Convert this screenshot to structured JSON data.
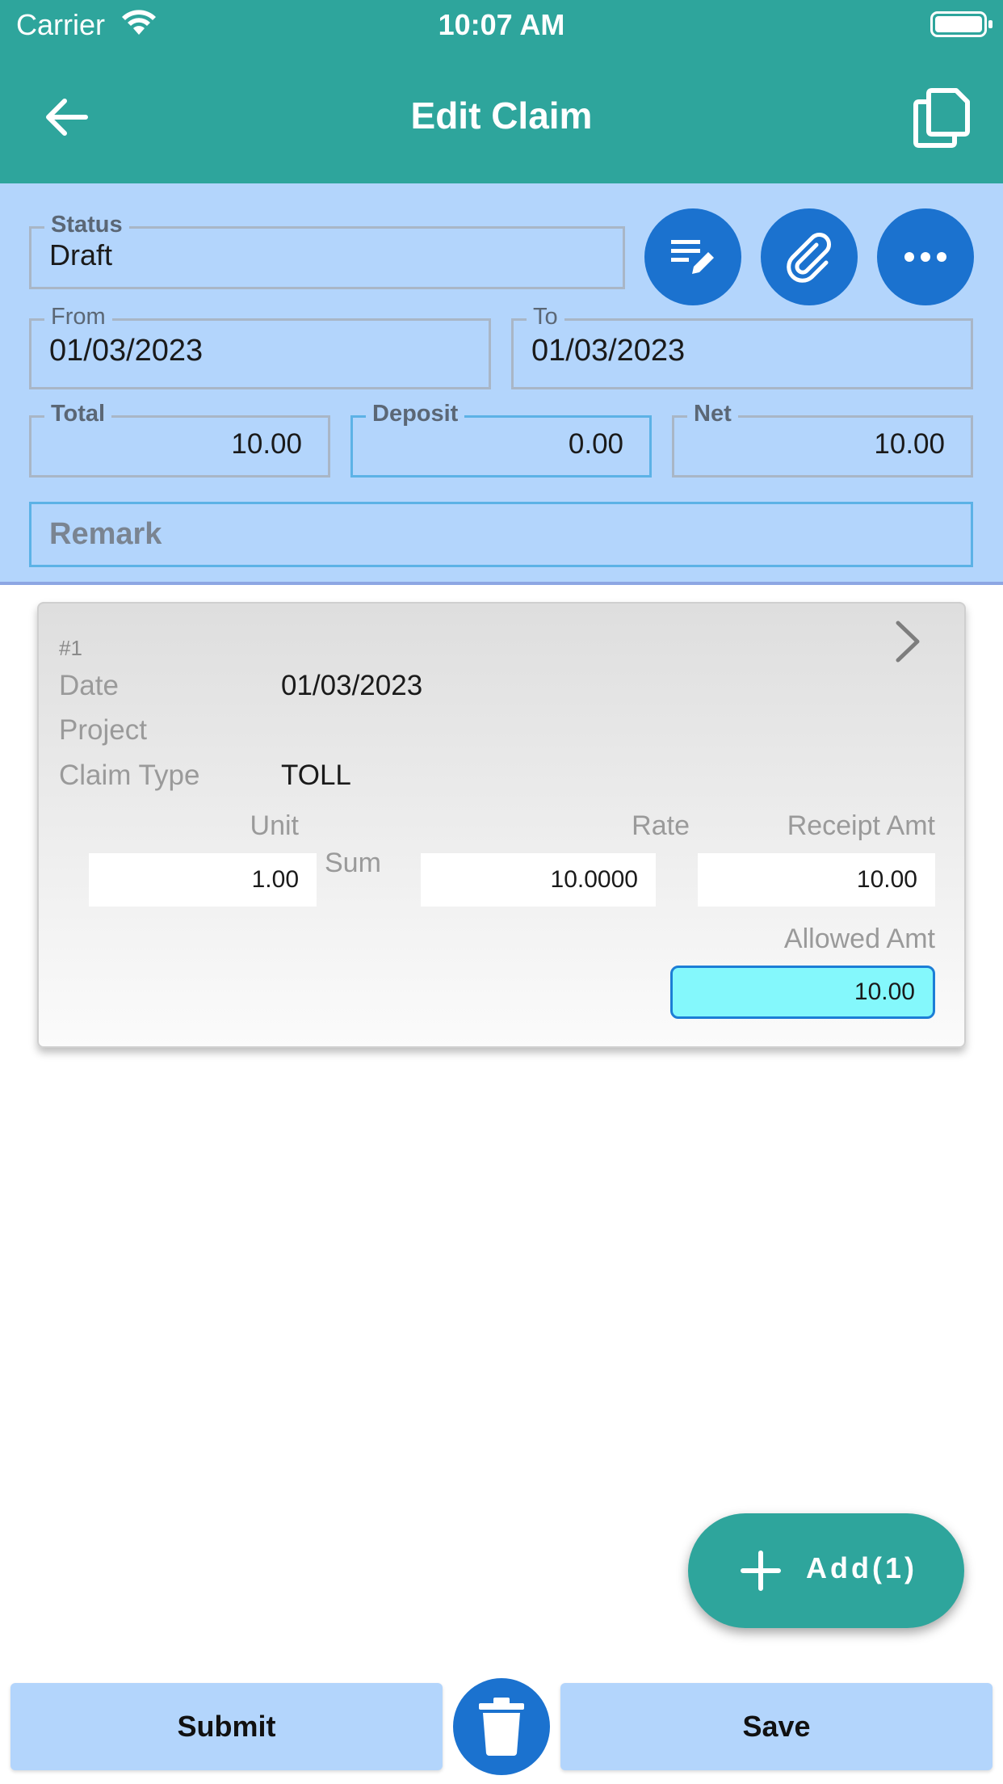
{
  "status_bar": {
    "carrier": "Carrier",
    "time": "10:07 AM"
  },
  "app_bar": {
    "title": "Edit Claim",
    "back_icon": "arrow-back-icon",
    "copy_icon": "copy-icon"
  },
  "header": {
    "status": {
      "label": "Status",
      "value": "Draft"
    },
    "actions": [
      {
        "icon": "edit-notes-icon"
      },
      {
        "icon": "paperclip-icon"
      },
      {
        "icon": "more-horizontal-icon"
      }
    ],
    "from": {
      "label": "From",
      "value": "01/03/2023"
    },
    "to": {
      "label": "To",
      "value": "01/03/2023"
    },
    "total": {
      "label": "Total",
      "value": "10.00"
    },
    "deposit": {
      "label": "Deposit",
      "value": "0.00"
    },
    "net": {
      "label": "Net",
      "value": "10.00"
    },
    "remark": {
      "placeholder": "Remark",
      "value": ""
    }
  },
  "claim_items": [
    {
      "index": "#1",
      "date_label": "Date",
      "date": "01/03/2023",
      "project_label": "Project",
      "project": "",
      "claim_type_label": "Claim Type",
      "claim_type": "TOLL",
      "unit_label": "Unit",
      "unit": "1.00",
      "sum_label": "Sum",
      "rate_label": "Rate",
      "rate": "10.0000",
      "receipt_label": "Receipt Amt",
      "receipt_amt": "10.00",
      "allowed_label": "Allowed Amt",
      "allowed_amt": "10.00"
    }
  ],
  "fab": {
    "label": "Add(1)",
    "icon": "plus-icon"
  },
  "bottom_bar": {
    "submit": "Submit",
    "save": "Save",
    "delete_icon": "trash-icon"
  },
  "colors": {
    "primary": "#2ea59c",
    "accent": "#1b72cf",
    "form_bg": "#b3d5fc",
    "highlight": "#84f8fc"
  }
}
